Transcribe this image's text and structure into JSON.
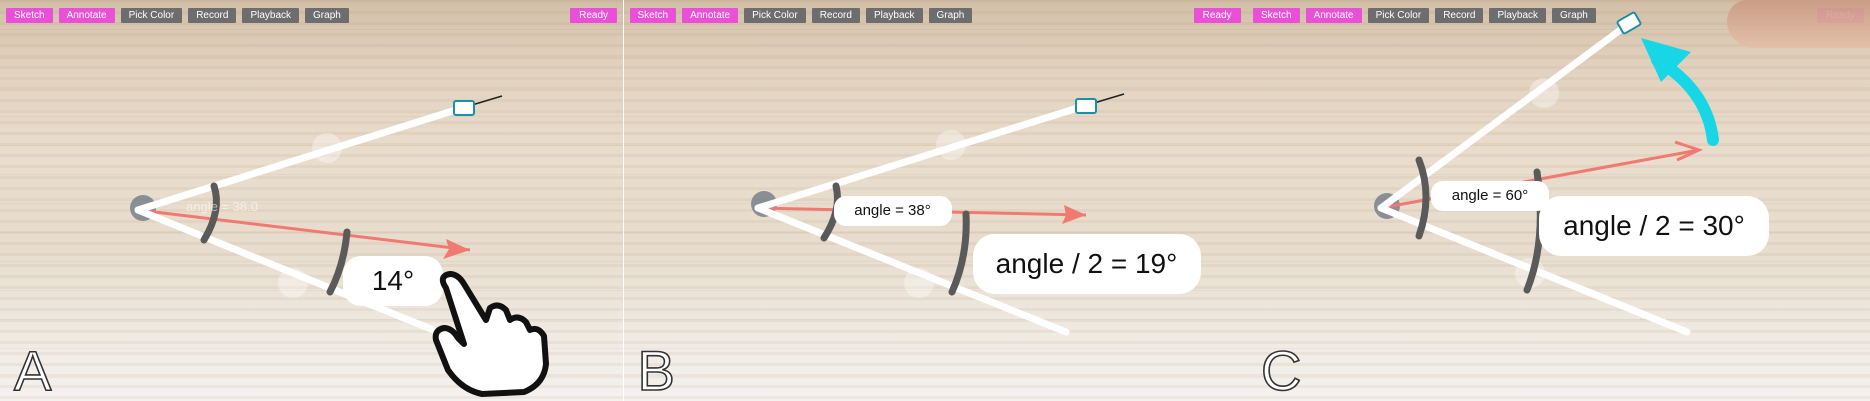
{
  "toolbar": {
    "sketch": "Sketch",
    "annotate": "Annotate",
    "pick_color": "Pick Color",
    "record": "Record",
    "playback": "Playback",
    "graph": "Graph",
    "status": "Ready"
  },
  "panels": [
    {
      "letter": "A",
      "angle_label": "angle = 38.0",
      "measure_label": "14°"
    },
    {
      "letter": "B",
      "angle_label": "angle = 38°",
      "measure_label": "angle / 2 = 19°"
    },
    {
      "letter": "C",
      "angle_label": "angle = 60°",
      "measure_label": "angle / 2 = 30°"
    }
  ],
  "colors": {
    "accent": "#ea4fd8",
    "toolbar_gray": "#6d6d6d",
    "arm": "#ffffff",
    "arc": "#5a5a5a",
    "arrow": "#f07a72",
    "cyan_arrow": "#17d7e6"
  },
  "icons": {
    "pointer": "hand-pointer-icon",
    "rotate": "curved-arrow-icon"
  }
}
